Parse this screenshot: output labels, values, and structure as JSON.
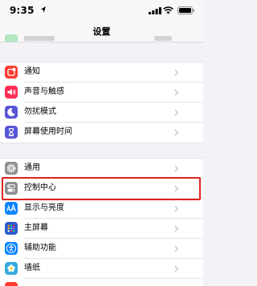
{
  "status_bar": {
    "time": "9:35",
    "icons": [
      "location-arrow-icon",
      "cellular-signal-icon",
      "wifi-icon",
      "battery-icon"
    ]
  },
  "nav": {
    "title": "设置"
  },
  "groups": [
    {
      "items": [
        {
          "label": "通知",
          "icon": "notifications-icon",
          "color": "#ff3b30"
        },
        {
          "label": "声音与触感",
          "icon": "speaker-icon",
          "color": "#ff2d55"
        },
        {
          "label": "勿扰模式",
          "icon": "moon-icon",
          "color": "#5856d6"
        },
        {
          "label": "屏幕使用时间",
          "icon": "hourglass-icon",
          "color": "#5856d6"
        }
      ]
    },
    {
      "items": [
        {
          "label": "通用",
          "icon": "gear-icon",
          "color": "#8e8e93"
        },
        {
          "label": "控制中心",
          "icon": "toggles-icon",
          "color": "#8e8e93",
          "highlighted": true
        },
        {
          "label": "显示与亮度",
          "icon": "text-size-icon",
          "color": "#0a84ff"
        },
        {
          "label": "主屏幕",
          "icon": "home-grid-icon",
          "color": "#2c59d1"
        },
        {
          "label": "辅助功能",
          "icon": "accessibility-icon",
          "color": "#0a84ff"
        },
        {
          "label": "墙纸",
          "icon": "wallpaper-flower-icon",
          "color": "#34aadc"
        }
      ]
    }
  ],
  "colors": {
    "highlight": "#e0221e",
    "background": "#f2f2f7",
    "chevron": "#c7c7cc"
  }
}
